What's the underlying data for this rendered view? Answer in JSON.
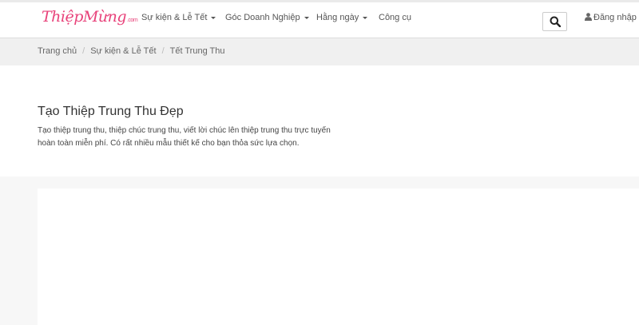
{
  "header": {
    "logo_text": "ThiệpMừng",
    "logo_suffix": ".com",
    "nav": [
      {
        "label": "Sự kiện & Lễ Tết",
        "has_dropdown": true
      },
      {
        "label": "Góc Doanh Nghiệp",
        "has_dropdown": true
      },
      {
        "label": "Hằng ngày",
        "has_dropdown": true
      },
      {
        "label": "Công cụ",
        "has_dropdown": false
      }
    ],
    "search_icon": "search-icon",
    "login_icon": "user-icon",
    "login_label": "Đăng nhập"
  },
  "breadcrumb": {
    "items": [
      "Trang chủ",
      "Sự kiện & Lễ Tết",
      "Tết Trung Thu"
    ],
    "separator": "/"
  },
  "hero": {
    "title": "Tạo Thiệp Trung Thu Đẹp",
    "description": "Tạo thiệp trung thu, thiệp chúc trung thu, viết lời chúc lên thiệp trung thu trực tuyến hoàn toàn miễn phí. Có rất nhiều mẫu thiết kế cho bạn thỏa sức lựa chọn."
  },
  "colors": {
    "logo": "#e8427a",
    "nav_text": "#555555",
    "breadcrumb_bg": "#f0f0f0",
    "page_bg": "#f7f7f7"
  }
}
